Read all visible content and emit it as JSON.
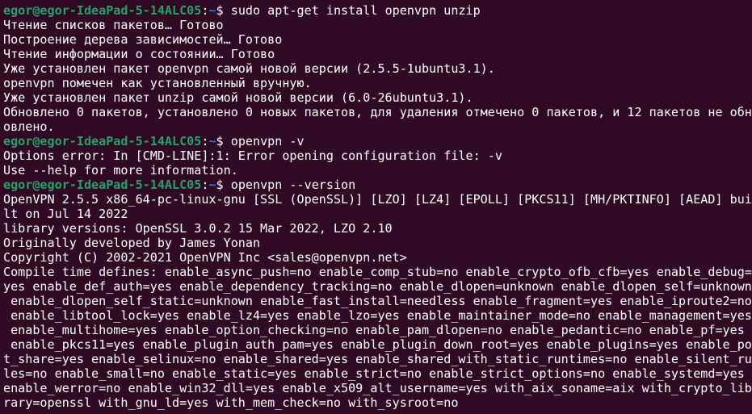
{
  "theme": {
    "background": "#300a24",
    "foreground": "#ffffff",
    "prompt_user_color": "#26a269",
    "prompt_path_color": "#2a7bde"
  },
  "prompt": {
    "user_host": "egor@egor-IdeaPad-5-14ALC05",
    "colon": ":",
    "path": "~",
    "symbol": "$ "
  },
  "lines": [
    {
      "type": "prompt",
      "command": "sudo apt-get install openvpn unzip"
    },
    {
      "type": "output",
      "text": "Чтение списков пакетов… Готово"
    },
    {
      "type": "output",
      "text": "Построение дерева зависимостей… Готово"
    },
    {
      "type": "output",
      "text": "Чтение информации о состоянии… Готово"
    },
    {
      "type": "output",
      "text": "Уже установлен пакет openvpn самой новой версии (2.5.5-1ubuntu3.1)."
    },
    {
      "type": "output",
      "text": "openvpn помечен как установленный вручную."
    },
    {
      "type": "output",
      "text": "Уже установлен пакет unzip самой новой версии (6.0-26ubuntu3.1)."
    },
    {
      "type": "output",
      "text": "Обновлено 0 пакетов, установлено 0 новых пакетов, для удаления отмечено 0 пакетов, и 12 пакетов не обн"
    },
    {
      "type": "output",
      "text": "овлено."
    },
    {
      "type": "prompt",
      "command": "openvpn -v"
    },
    {
      "type": "output",
      "text": "Options error: In [CMD-LINE]:1: Error opening configuration file: -v"
    },
    {
      "type": "output",
      "text": "Use --help for more information."
    },
    {
      "type": "prompt",
      "command": "openvpn --version"
    },
    {
      "type": "output",
      "text": "OpenVPN 2.5.5 x86_64-pc-linux-gnu [SSL (OpenSSL)] [LZO] [LZ4] [EPOLL] [PKCS11] [MH/PKTINFO] [AEAD] bui"
    },
    {
      "type": "output",
      "text": "lt on Jul 14 2022"
    },
    {
      "type": "output",
      "text": "library versions: OpenSSL 3.0.2 15 Mar 2022, LZO 2.10"
    },
    {
      "type": "output",
      "text": "Originally developed by James Yonan"
    },
    {
      "type": "output",
      "text": "Copyright (C) 2002-2021 OpenVPN Inc <sales@openvpn.net>"
    },
    {
      "type": "output",
      "text": "Compile time defines: enable_async_push=no enable_comp_stub=no enable_crypto_ofb_cfb=yes enable_debug="
    },
    {
      "type": "output",
      "text": "yes enable_def_auth=yes enable_dependency_tracking=no enable_dlopen=unknown enable_dlopen_self=unknown"
    },
    {
      "type": "output",
      "text": " enable_dlopen_self_static=unknown enable_fast_install=needless enable_fragment=yes enable_iproute2=no"
    },
    {
      "type": "output",
      "text": " enable_libtool_lock=yes enable_lz4=yes enable_lzo=yes enable_maintainer_mode=no enable_management=yes"
    },
    {
      "type": "output",
      "text": " enable_multihome=yes enable_option_checking=no enable_pam_dlopen=no enable_pedantic=no enable_pf=yes"
    },
    {
      "type": "output",
      "text": " enable_pkcs11=yes enable_plugin_auth_pam=yes enable_plugin_down_root=yes enable_plugins=yes enable_por"
    },
    {
      "type": "output",
      "text": "t_share=yes enable_selinux=no enable_shared=yes enable_shared_with_static_runtimes=no enable_silent_ru"
    },
    {
      "type": "output",
      "text": "les=no enable_small=no enable_static=yes enable_strict=no enable_strict_options=no enable_systemd=yes"
    },
    {
      "type": "output",
      "text": "enable_werror=no enable_win32_dll=yes enable_x509_alt_username=yes with_aix_soname=aix with_crypto_lib"
    },
    {
      "type": "output",
      "text": "rary=openssl with_gnu_ld=yes with_mem_check=no with_sysroot=no"
    }
  ]
}
